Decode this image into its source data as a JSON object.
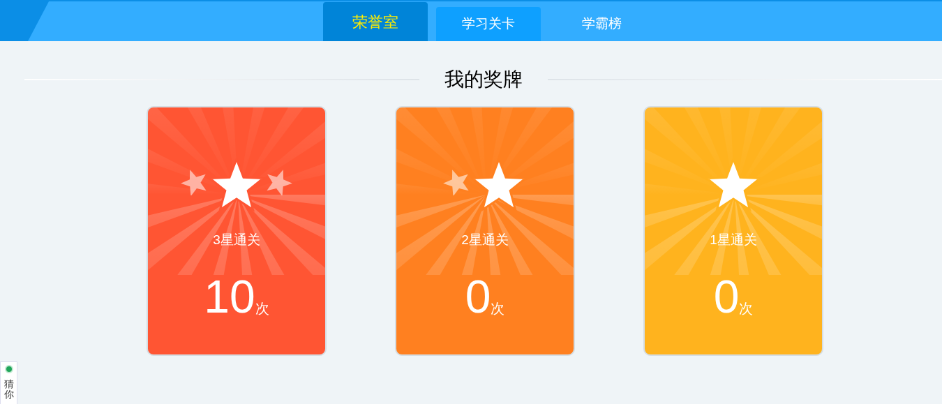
{
  "tabs": [
    {
      "label": "荣誉室",
      "selected": true,
      "highlighted": false
    },
    {
      "label": "学习关卡",
      "selected": false,
      "highlighted": true
    },
    {
      "label": "学霸榜",
      "selected": false,
      "highlighted": false
    }
  ],
  "section_title": "我的奖牌",
  "medals": [
    {
      "label": "3星通关",
      "count": "10",
      "unit": "次",
      "kind": "triple",
      "color": "#ff5533"
    },
    {
      "label": "2星通关",
      "count": "0",
      "unit": "次",
      "kind": "double",
      "color": "#ff8020"
    },
    {
      "label": "1星通关",
      "count": "0",
      "unit": "次",
      "kind": "single",
      "color": "#ffb31e"
    }
  ],
  "side_widget": {
    "text": "猜你"
  }
}
